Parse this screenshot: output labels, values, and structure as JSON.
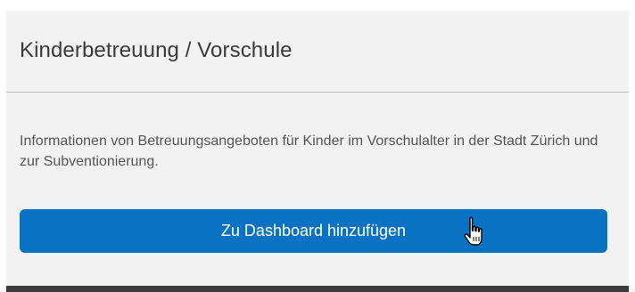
{
  "card": {
    "title": "Kinderbetreuung / Vorschule",
    "description": "Informationen von Betreuungsangeboten für Kinder im Vorschulalter in der Stadt Zürich und zur Subventionierung.",
    "button_label": "Zu Dashboard hinzufügen"
  },
  "cursor": {
    "icon": "hand-pointer-icon"
  },
  "colors": {
    "button_background": "#0a72c2",
    "card_background": "#f2f2f2",
    "footer_bar": "#3d3d3d"
  }
}
